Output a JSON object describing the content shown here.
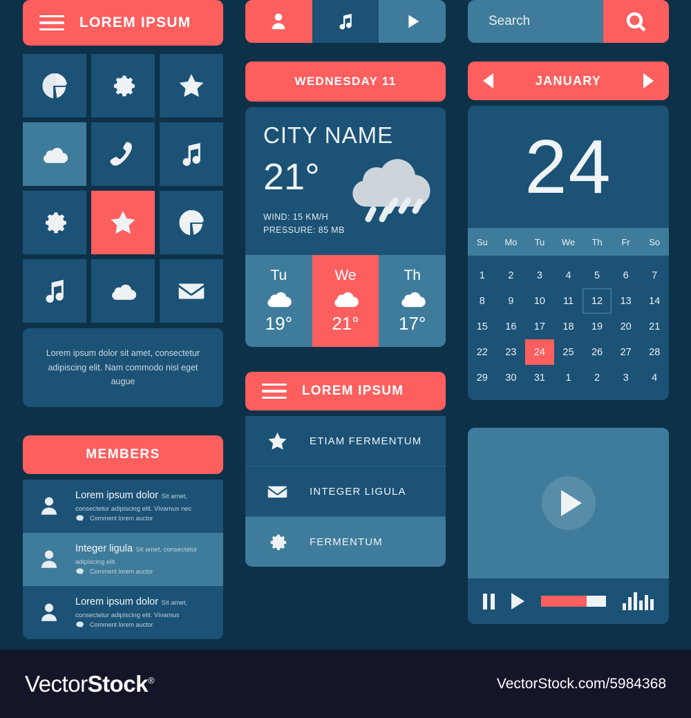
{
  "theme": {
    "background": "#0d3148",
    "accent": "#fd5f5f",
    "tile": "#1b5276",
    "tile_light": "#3f7c9b",
    "text": "#f0f4f7"
  },
  "app_header": {
    "title": "LOREM IPSUM",
    "menu_icon": "hamburger-icon"
  },
  "icon_grid": [
    {
      "icon": "pie-chart-icon",
      "state": "normal"
    },
    {
      "icon": "gear-icon",
      "state": "normal"
    },
    {
      "icon": "star-icon",
      "state": "normal"
    },
    {
      "icon": "cloud-icon",
      "state": "light"
    },
    {
      "icon": "phone-icon",
      "state": "normal"
    },
    {
      "icon": "music-note-icon",
      "state": "normal"
    },
    {
      "icon": "gear-icon",
      "state": "normal"
    },
    {
      "icon": "star-icon",
      "state": "active"
    },
    {
      "icon": "pie-chart-icon",
      "state": "normal"
    },
    {
      "icon": "music-note-icon",
      "state": "normal"
    },
    {
      "icon": "cloud-icon",
      "state": "normal"
    },
    {
      "icon": "envelope-icon",
      "state": "normal"
    }
  ],
  "caption": {
    "text": "Lorem ipsum dolor sit amet, consectetur adipiscing elit. Nam commodo nisl eget augue"
  },
  "segmented_control": [
    {
      "icon": "user-icon",
      "state": "active"
    },
    {
      "icon": "music-note-icon",
      "state": "normal"
    },
    {
      "icon": "play-icon",
      "state": "light"
    }
  ],
  "weather": {
    "date_label": "WEDNESDAY 11",
    "city": "CITY NAME",
    "temperature": "21°",
    "condition_icon": "rain-cloud-icon",
    "wind": "WIND: 15 KM/H",
    "pressure": "PRESSURE: 85 MB",
    "forecast": [
      {
        "day": "Tu",
        "icon": "cloud-icon",
        "temp": "19°",
        "state": "normal"
      },
      {
        "day": "We",
        "icon": "cloud-icon",
        "temp": "21°",
        "state": "active"
      },
      {
        "day": "Th",
        "icon": "cloud-icon",
        "temp": "17°",
        "state": "normal"
      }
    ]
  },
  "search": {
    "placeholder": "Search",
    "button_icon": "search-icon"
  },
  "calendar": {
    "month": "JANUARY",
    "prev_icon": "arrow-left-icon",
    "next_icon": "arrow-right-icon",
    "selected_day_big": "24",
    "weekdays": [
      "Su",
      "Mo",
      "Tu",
      "We",
      "Th",
      "Fr",
      "So"
    ],
    "days": [
      {
        "n": "1"
      },
      {
        "n": "2"
      },
      {
        "n": "3"
      },
      {
        "n": "4"
      },
      {
        "n": "5"
      },
      {
        "n": "6"
      },
      {
        "n": "7"
      },
      {
        "n": "8"
      },
      {
        "n": "9"
      },
      {
        "n": "10"
      },
      {
        "n": "11"
      },
      {
        "n": "12",
        "state": "outlined"
      },
      {
        "n": "13"
      },
      {
        "n": "14"
      },
      {
        "n": "15"
      },
      {
        "n": "16"
      },
      {
        "n": "17"
      },
      {
        "n": "18"
      },
      {
        "n": "19"
      },
      {
        "n": "20"
      },
      {
        "n": "21"
      },
      {
        "n": "22"
      },
      {
        "n": "23"
      },
      {
        "n": "24",
        "state": "selected"
      },
      {
        "n": "25"
      },
      {
        "n": "26"
      },
      {
        "n": "27"
      },
      {
        "n": "28"
      },
      {
        "n": "29"
      },
      {
        "n": "30"
      },
      {
        "n": "31"
      },
      {
        "n": "1"
      },
      {
        "n": "2"
      },
      {
        "n": "3"
      },
      {
        "n": "4"
      }
    ]
  },
  "members": {
    "title": "MEMBERS",
    "items": [
      {
        "avatar": "user-icon",
        "name": "Lorem ipsum dolor",
        "subtitle": "Sit amet, consectetur adipiscing elit. Vivamus nec",
        "comment": "Comment lorem auctor",
        "comment_icon": "comment-icon",
        "state": "normal"
      },
      {
        "avatar": "user-icon",
        "name": "Integer ligula",
        "subtitle": "Sit amet, consectetur adipiscing elit.",
        "comment": "Comment lorem auctor",
        "comment_icon": "comment-icon",
        "state": "active"
      },
      {
        "avatar": "user-icon",
        "name": "Lorem ipsum dolor",
        "subtitle": "Sit amet, consectetur adipiscing elit. Vivamus",
        "comment": "Comment lorem auctor",
        "comment_icon": "comment-icon",
        "state": "normal"
      }
    ]
  },
  "menu_list": {
    "header": {
      "title": "LOREM IPSUM",
      "menu_icon": "hamburger-icon"
    },
    "items": [
      {
        "icon": "star-icon",
        "label": "ETIAM FERMENTUM",
        "state": "normal"
      },
      {
        "icon": "envelope-icon",
        "label": "INTEGER LIGULA",
        "state": "normal"
      },
      {
        "icon": "gear-icon",
        "label": "FERMENTUM",
        "state": "active"
      }
    ]
  },
  "player": {
    "big_play_icon": "play-circle-icon",
    "pause_icon": "pause-icon",
    "play_icon": "play-icon",
    "progress_percent": 70,
    "equalizer_icon": "equalizer-icon",
    "equalizer_bars": [
      40,
      75,
      100,
      55,
      85,
      60
    ]
  },
  "footer": {
    "brand": "VectorStock",
    "trademark": "®",
    "url": "VectorStock.com/5984368"
  }
}
